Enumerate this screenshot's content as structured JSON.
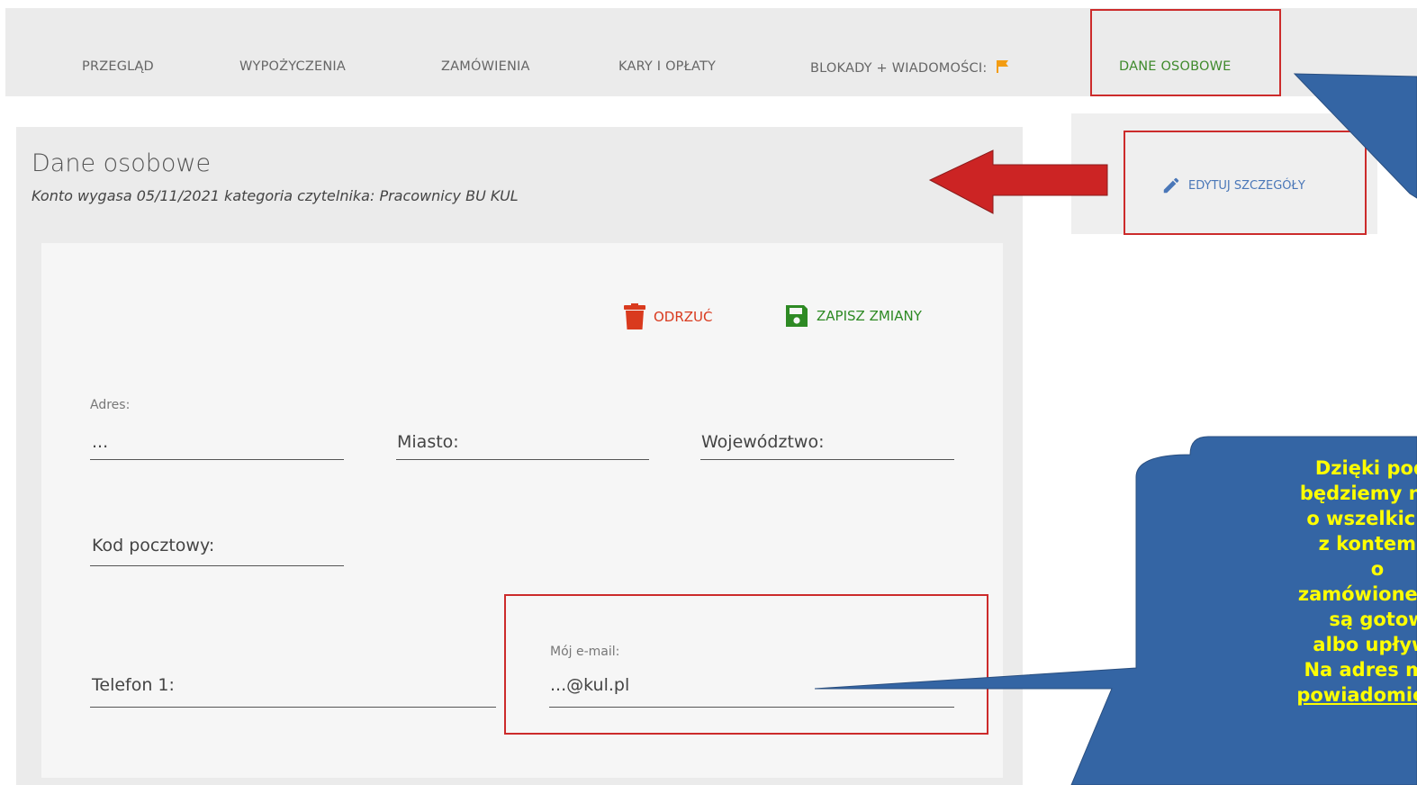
{
  "tabs": [
    {
      "label": "PRZEGLĄD"
    },
    {
      "label": "WYPOŻYCZENIA"
    },
    {
      "label": "ZAMÓWIENIA"
    },
    {
      "label": "KARY I OPŁATY"
    },
    {
      "label": "BLOKADY + WIADOMOŚCI:"
    },
    {
      "label": "DANE OSOBOWE"
    }
  ],
  "panel": {
    "title": "Dane osobowe",
    "subtitle": "Konto wygasa 05/11/2021 kategoria czytelnika: Pracownicy BU KUL"
  },
  "actions": {
    "discard_label": "ODRZUĆ",
    "save_label": "ZAPISZ ZMIANY"
  },
  "form": {
    "address_label": "Adres:",
    "address_value": "...",
    "city_label": "Miasto:",
    "province_label": "Województwo:",
    "postcode_label": "Kod pocztowy:",
    "phone_label": "Telefon 1:",
    "email_label": "Mój e-mail:",
    "email_value": "...@kul.pl"
  },
  "sidebar": {
    "edit_label": "EDYTUJ SZCZEGÓŁY"
  },
  "callout": {
    "lines": [
      "Dzięki poda",
      "będziemy na b",
      "o wszelkich a",
      "z kontem b",
      "o",
      "zamówione ma",
      "są gotow",
      "albo upływa",
      "Na adres mail",
      "powiadomienia"
    ]
  },
  "colors": {
    "accent_green": "#3f8a2c",
    "discard_red": "#d93a1e",
    "annotation_red": "#cc2b2b",
    "callout_blue": "#3465a4",
    "callout_text": "#ffff00",
    "edit_blue": "#4a77b8",
    "flag_orange": "#f39c12"
  },
  "icons": {
    "flag": "flag-icon",
    "trash": "trash-icon",
    "save": "floppy-disk-icon",
    "edit": "pencil-icon"
  }
}
